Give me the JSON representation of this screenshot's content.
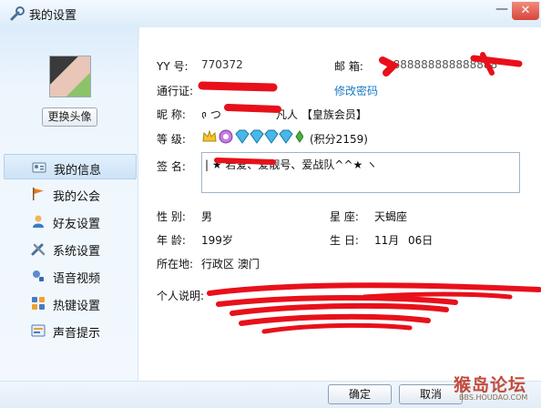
{
  "window": {
    "title": "我的设置",
    "minimize_label": "—",
    "close_label": "✕"
  },
  "sidebar": {
    "change_avatar_label": "更换头像",
    "items": [
      {
        "label": "我的信息",
        "icon": "id-card-icon",
        "active": true
      },
      {
        "label": "我的公会",
        "icon": "flag-icon",
        "active": false
      },
      {
        "label": "好友设置",
        "icon": "person-icon",
        "active": false
      },
      {
        "label": "系统设置",
        "icon": "tools-icon",
        "active": false
      },
      {
        "label": "语音视频",
        "icon": "microphone-icon",
        "active": false
      },
      {
        "label": "热键设置",
        "icon": "keyboard-icon",
        "active": false
      },
      {
        "label": "声音提示",
        "icon": "speaker-icon",
        "active": false
      }
    ]
  },
  "profile": {
    "yy_label": "YY  号:",
    "yy_value": "770372",
    "email_label": "邮  箱:",
    "email_value": "8888888888888888",
    "passport_label": "通行证:",
    "change_password_label": "修改密码",
    "nickname_label": "昵  称:",
    "nickname_value": "᱉ つ",
    "nickname_suffix": "凡人  【皇族会员】",
    "level_label": "等  级:",
    "level_badges": [
      "crown",
      "purple-orb",
      "blue-diamond",
      "blue-diamond",
      "blue-diamond",
      "blue-diamond",
      "green-leaf"
    ],
    "points_text": "(积分2159)",
    "signature_label": "签  名:",
    "signature_value": "|  ★        若爱、爱靓号、爱战队^^★ ヽ",
    "gender_label": "性  别:",
    "gender_value": "男",
    "constellation_label": "星  座:",
    "constellation_value": "天蝎座",
    "age_label": "年  龄:",
    "age_value": "199岁",
    "birthday_label": "生  日:",
    "birthday_month": "11月",
    "birthday_day": "06日",
    "location_label": "所在地:",
    "location_value": "行政区  澳门",
    "intro_label": "个人说明:"
  },
  "footer": {
    "ok_label": "确定",
    "cancel_label": "取消"
  },
  "watermark": {
    "text": "猴岛论坛",
    "sub": "BBS.HOUDAO.COM"
  },
  "colors": {
    "accent": "#1a7bc4",
    "scribble": "#e8101a",
    "title_bg": "#dcecfa"
  }
}
